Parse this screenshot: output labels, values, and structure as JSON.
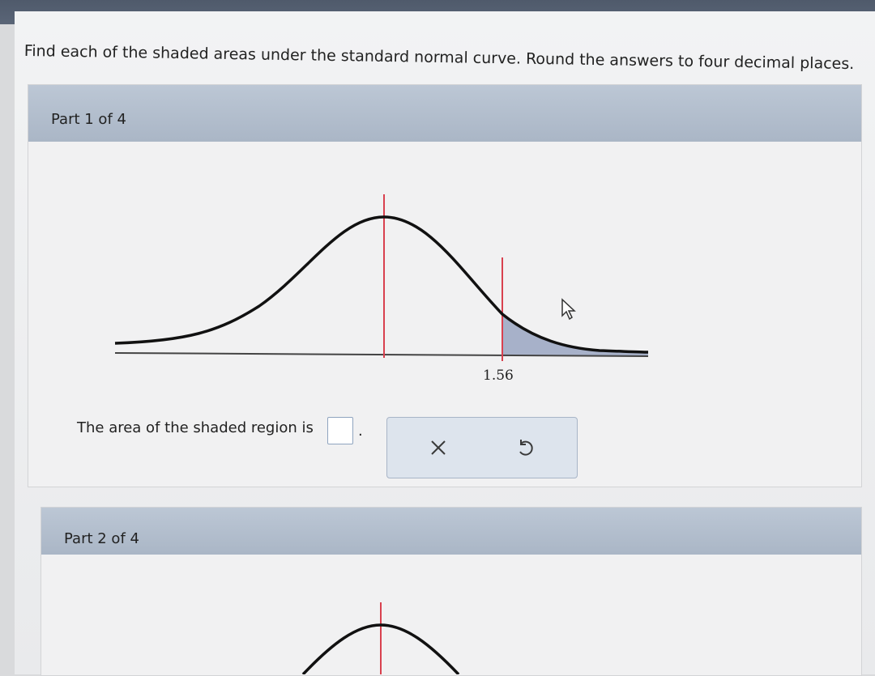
{
  "instructions": "Find each of the shaded areas under the standard normal curve. Round the answers to four decimal places.",
  "parts": [
    {
      "header": "Part 1 of 4",
      "z_value_label": "1.56",
      "answer_prompt": "The area of the shaded region is",
      "answer_value": "",
      "period": ".",
      "buttons": {
        "clear_icon": "x-icon",
        "undo_icon": "undo-icon"
      }
    },
    {
      "header": "Part 2 of 4"
    }
  ],
  "colors": {
    "shade": "#9aa6c2",
    "marker_line": "#d9414f",
    "header": "#b4c0cf"
  }
}
